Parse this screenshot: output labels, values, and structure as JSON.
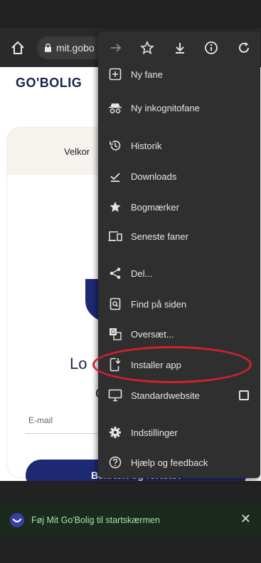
{
  "toolbar": {
    "url": "mit.gobo"
  },
  "page": {
    "logo": "GO'BOLIG",
    "welcome": "Velkor",
    "login_title": "Lo",
    "login_sub": "c",
    "email_label": "E-mail",
    "confirm_label": "Bekræft og fortsæt"
  },
  "menu": {
    "items": [
      {
        "label": "Ny fane",
        "icon": "new-tab-icon"
      },
      {
        "label": "Ny inkognitofane",
        "icon": "incognito-icon"
      },
      {
        "label": "Historik",
        "icon": "history-icon"
      },
      {
        "label": "Downloads",
        "icon": "downloads-icon"
      },
      {
        "label": "Bogmærker",
        "icon": "star-icon"
      },
      {
        "label": "Seneste faner",
        "icon": "recent-tabs-icon"
      },
      {
        "label": "Del...",
        "icon": "share-icon"
      },
      {
        "label": "Find på siden",
        "icon": "find-in-page-icon"
      },
      {
        "label": "Oversæt...",
        "icon": "translate-icon"
      },
      {
        "label": "Installer app",
        "icon": "install-app-icon"
      },
      {
        "label": "Standardwebsite",
        "icon": "desktop-site-icon"
      },
      {
        "label": "Indstillinger",
        "icon": "settings-icon"
      },
      {
        "label": "Hjælp og feedback",
        "icon": "help-icon"
      }
    ]
  },
  "banner": {
    "text": "Føj Mit Go'Bolig til startskærmen"
  },
  "colors": {
    "highlight": "#d3202f",
    "brand_navy": "#1d2a73",
    "banner_text": "#9fe6ad"
  }
}
